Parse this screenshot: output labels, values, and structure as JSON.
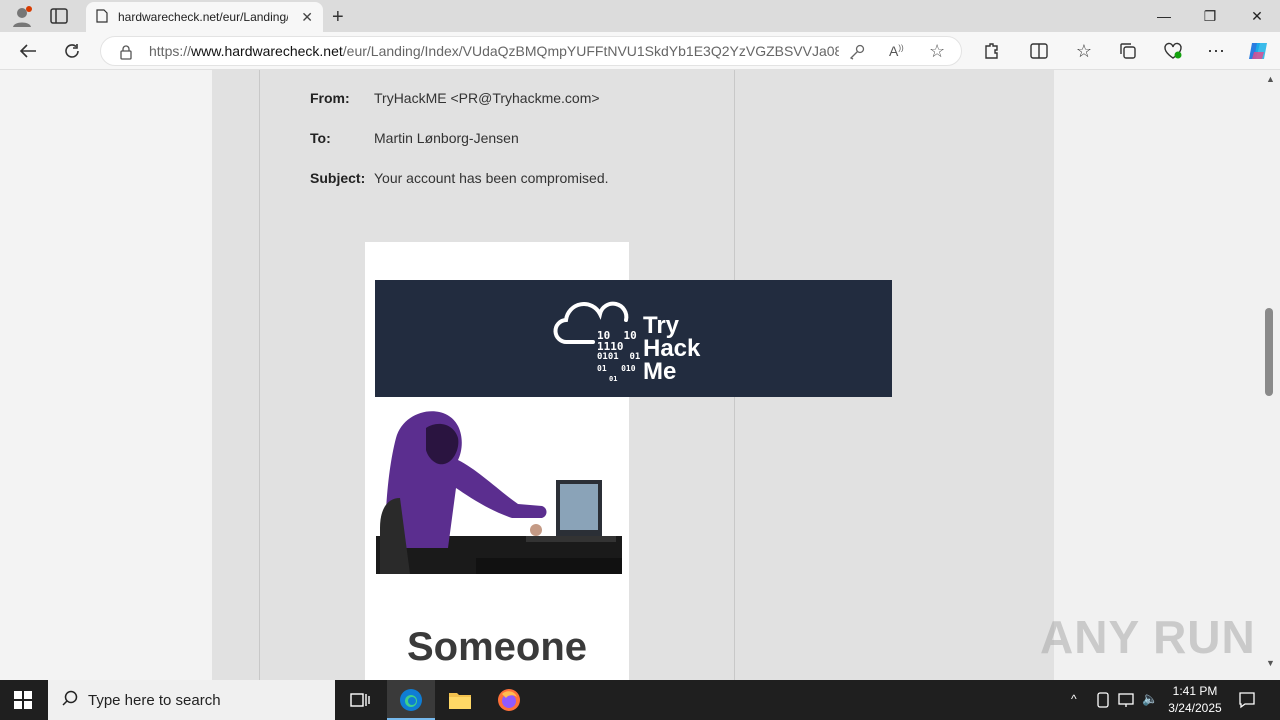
{
  "browser": {
    "tab_title": "hardwarecheck.net/eur/Landing/",
    "url_prefix": "https://",
    "url_domain": "www.hardwarecheck.net",
    "url_path": "/eur/Landing/Index/VUdaQzBMQmpYUFFtNVU1SkdYb1E3Q2YzVGZBSVVJa08x..."
  },
  "email": {
    "from_label": "From:",
    "from_value": "TryHackME <PR@Tryhackme.com>",
    "to_label": "To:",
    "to_value": "Martin Lønborg-Jensen",
    "subject_label": "Subject:",
    "subject_value": "Your account has been compromised."
  },
  "banner": {
    "logo_word1": "Try",
    "logo_word2": "Hack",
    "logo_word3": "Me",
    "bin1": "10  10",
    "bin2": "1110",
    "bin3": "0101  01",
    "bin4": "01   010",
    "bin5": "01"
  },
  "body": {
    "headline": "Someone"
  },
  "watermark": "ANY RUN",
  "taskbar": {
    "search_placeholder": "Type here to search",
    "time": "1:41 PM",
    "date": "3/24/2025"
  },
  "colors": {
    "banner_bg": "#222c3f",
    "edge_accent": "#0078d4"
  }
}
